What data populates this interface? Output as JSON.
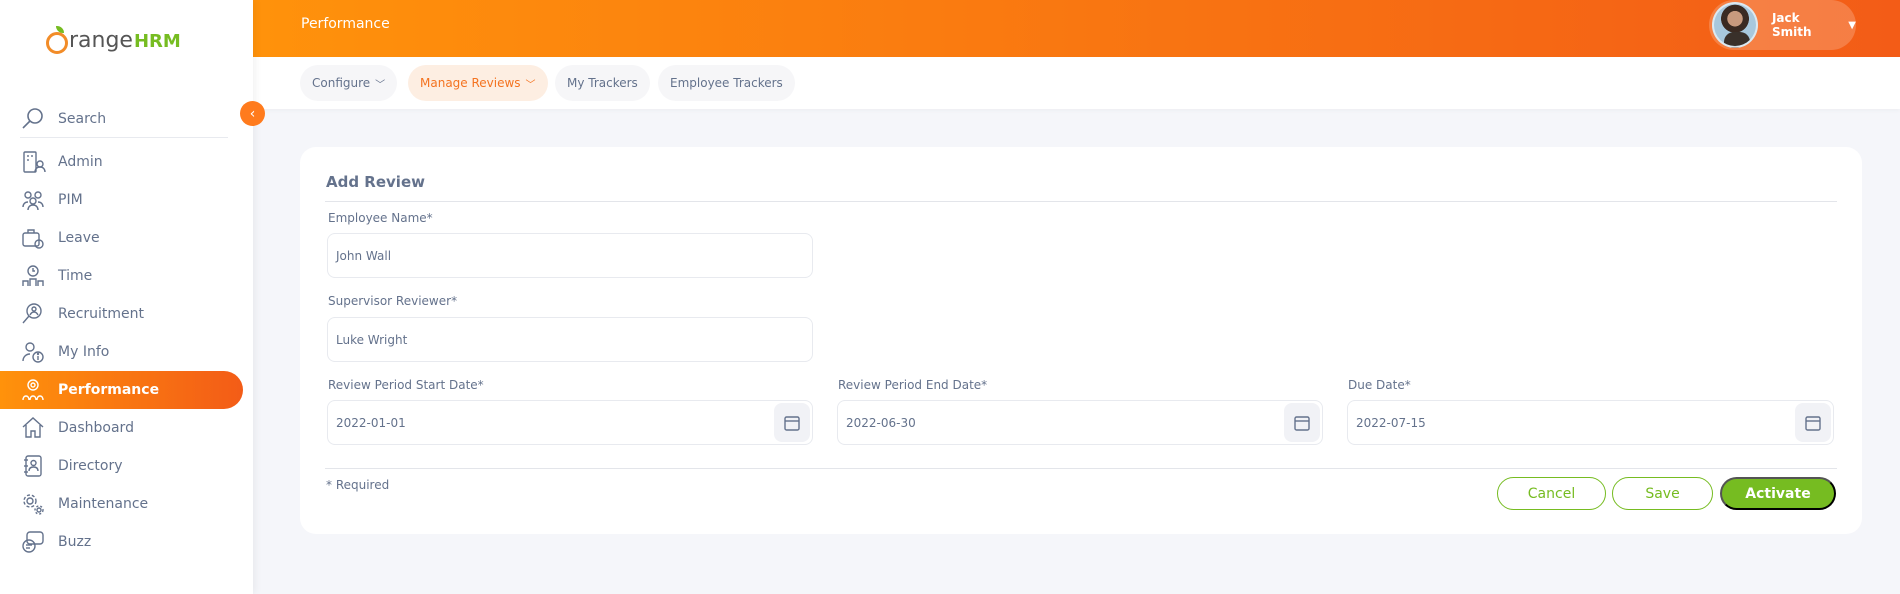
{
  "brand": {
    "name_part1": "range",
    "name_part2": "HRM"
  },
  "sidebar": {
    "search_label": "Search",
    "items": [
      {
        "label": "Admin",
        "icon": "admin-icon"
      },
      {
        "label": "PIM",
        "icon": "pim-icon"
      },
      {
        "label": "Leave",
        "icon": "leave-icon"
      },
      {
        "label": "Time",
        "icon": "time-icon"
      },
      {
        "label": "Recruitment",
        "icon": "recruitment-icon"
      },
      {
        "label": "My Info",
        "icon": "myinfo-icon"
      },
      {
        "label": "Performance",
        "icon": "performance-icon",
        "active": true
      },
      {
        "label": "Dashboard",
        "icon": "dashboard-icon"
      },
      {
        "label": "Directory",
        "icon": "directory-icon"
      },
      {
        "label": "Maintenance",
        "icon": "maintenance-icon"
      },
      {
        "label": "Buzz",
        "icon": "buzz-icon"
      }
    ]
  },
  "header": {
    "title": "Performance",
    "user_name": "Jack Smith"
  },
  "subnav": {
    "tabs": [
      {
        "label": "Configure",
        "has_dropdown": true
      },
      {
        "label": "Manage Reviews",
        "has_dropdown": true,
        "active": true
      },
      {
        "label": "My Trackers",
        "has_dropdown": false
      },
      {
        "label": "Employee Trackers",
        "has_dropdown": false
      }
    ]
  },
  "form": {
    "title": "Add Review",
    "employee_name": {
      "label": "Employee Name*",
      "value": "John  Wall"
    },
    "supervisor": {
      "label": "Supervisor Reviewer*",
      "value": "Luke  Wright"
    },
    "start_date": {
      "label": "Review Period Start Date*",
      "value": "2022-01-01"
    },
    "end_date": {
      "label": "Review Period End Date*",
      "value": "2022-06-30"
    },
    "due_date": {
      "label": "Due Date*",
      "value": "2022-07-15"
    },
    "required_note": "* Required",
    "buttons": {
      "cancel": "Cancel",
      "save": "Save",
      "activate": "Activate"
    }
  },
  "colors": {
    "accent": "#ff7b1d",
    "brand_green": "#76bc21",
    "text": "#64728c"
  }
}
